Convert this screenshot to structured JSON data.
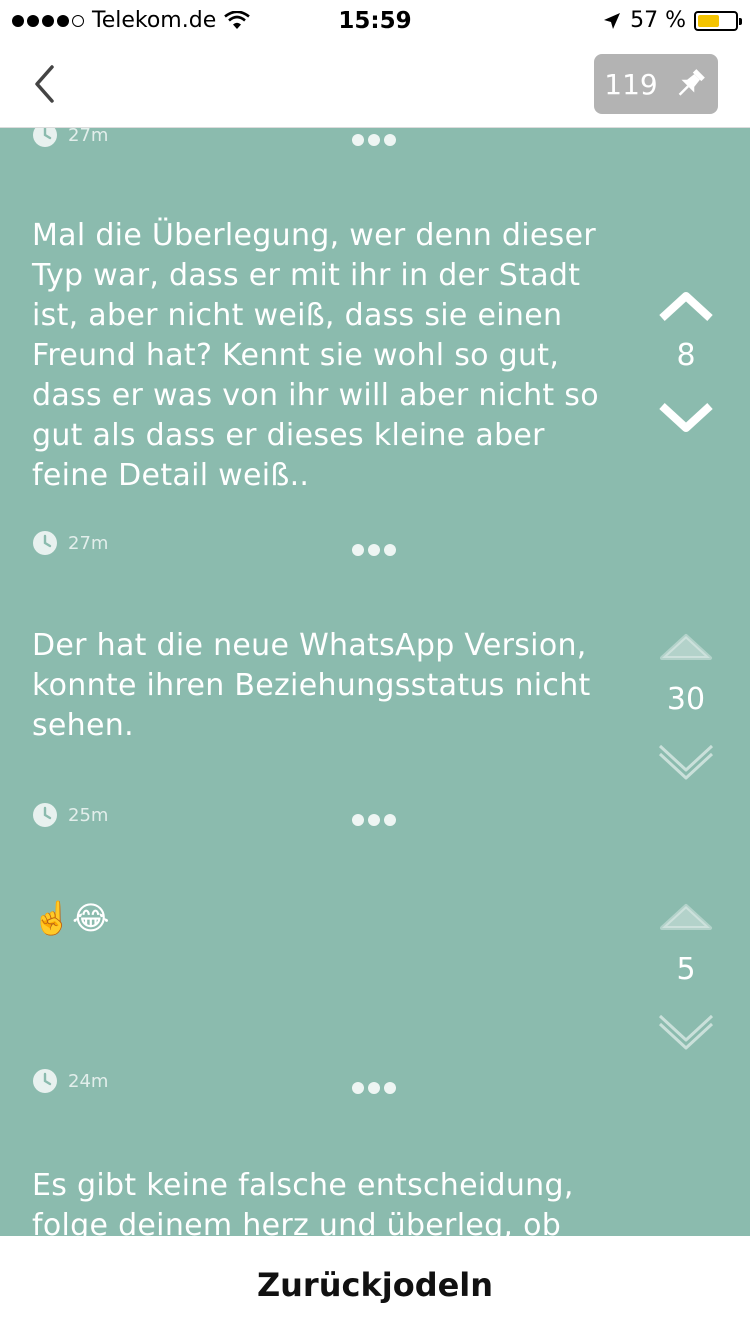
{
  "statusbar": {
    "carrier": "Telekom.de",
    "time": "15:59",
    "battery": "57 %",
    "battery_level": 0.57,
    "signal_bars": 4
  },
  "navbar": {
    "pin_count": "119"
  },
  "feed": {
    "top_partial_time": "27m",
    "posts": [
      {
        "text": "Mal die Überlegung, wer denn dieser Typ war, dass er mit ihr in der Stadt ist, aber nicht weiß, dass sie einen Freund hat? Kennt sie wohl so gut, dass er was von ihr will aber nicht so gut als dass er dieses kleine aber feine Detail weiß..",
        "votes": "8",
        "time": "27m"
      },
      {
        "text": "Der hat die neue WhatsApp Version, konnte ihren Beziehungsstatus nicht sehen.",
        "votes": "30",
        "time": "25m"
      },
      {
        "text": "☝️😂",
        "votes": "5",
        "time": "24m"
      },
      {
        "text": "Es gibt keine falsche entscheidung, folge deinem herz und überleg, ob"
      }
    ]
  },
  "bottom": {
    "reply_label": "Zurückjodeln"
  },
  "colors": {
    "background": "#8bbbae",
    "badge": "#b3b3b3",
    "battery": "#f5c400"
  }
}
